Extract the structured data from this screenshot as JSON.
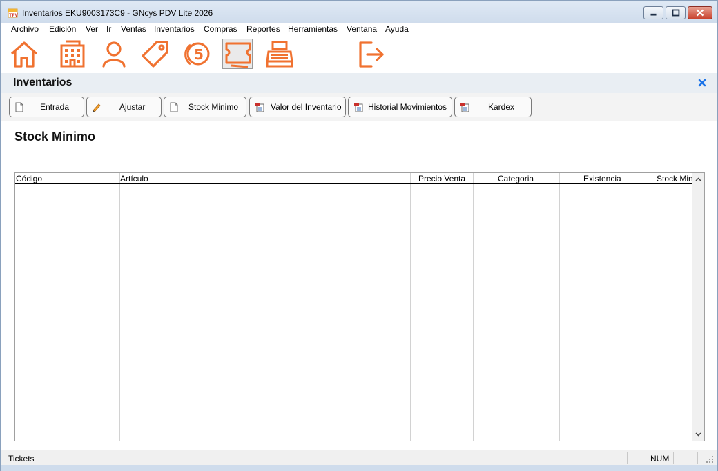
{
  "window": {
    "title": "Inventarios EKU9003173C9 - GNcys PDV Lite 2026",
    "app_icon": "tpv-app-icon"
  },
  "menu": [
    "Archivo",
    "Edición",
    "Ver",
    "Ir",
    "Ventas",
    "Inventarios",
    "Compras",
    "Reportes",
    "Herramientas",
    "Ventana",
    "Ayuda"
  ],
  "toolbar": {
    "accent_color": "#f07230",
    "icons": [
      "home-icon",
      "building-icon",
      "user-icon",
      "tag-icon",
      "coin-icon",
      "ticket-icon",
      "cash-register-icon",
      "exit-icon"
    ],
    "active": "ticket-icon"
  },
  "module": {
    "title": "Inventarios",
    "close_icon": "close-icon",
    "close_color": "#1a73e8"
  },
  "actions": [
    {
      "label": "Entrada",
      "icon": "document-icon"
    },
    {
      "label": "Ajustar",
      "icon": "pencil-icon"
    },
    {
      "label": "Stock Minimo",
      "icon": "document-icon"
    },
    {
      "label": "Valor del Inventario",
      "icon": "report-icon"
    },
    {
      "label": "Historial Movimientos",
      "icon": "report-icon"
    },
    {
      "label": "Kardex",
      "icon": "report-icon"
    }
  ],
  "section": {
    "title": "Stock Minimo"
  },
  "table": {
    "columns": [
      "Código",
      "Artículo",
      "Precio Venta",
      "Categoria",
      "Existencia",
      "Stock Min"
    ],
    "rows": []
  },
  "statusbar": {
    "left": "Tickets",
    "num": "NUM"
  }
}
